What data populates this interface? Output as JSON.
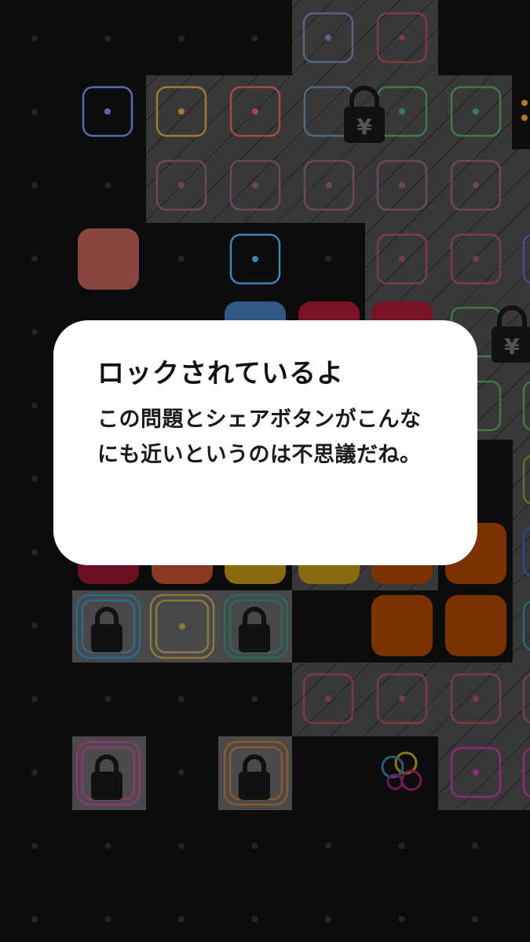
{
  "dialog": {
    "title": "ロックされているよ",
    "message": "この問題とシェアボタンがこんなにも近いというのは不思議だね。"
  },
  "board": {
    "background_color": "#0c0c0e",
    "dim_panel_color": "#36363a",
    "locked_panel_color": "#4a4a4c",
    "tiles": [
      {
        "kind": "outline",
        "color": "#5a6aa6",
        "cell": [
          1,
          1
        ],
        "icon": "dot-tile"
      },
      {
        "kind": "outline",
        "color": "#a07a34",
        "cell": [
          2,
          1
        ],
        "icon": "dot-tile"
      },
      {
        "kind": "outline",
        "color": "#a84a40",
        "cell": [
          3,
          1
        ],
        "icon": "dot-tile"
      },
      {
        "kind": "filled",
        "color": "#8a4540",
        "cell": [
          1,
          3
        ],
        "icon": "filled-tile"
      },
      {
        "kind": "outline",
        "color": "#3f86b0",
        "cell": [
          3,
          3
        ],
        "icon": "dot-tile"
      },
      {
        "kind": "filled",
        "color": "#315a86",
        "cell": [
          3,
          4
        ],
        "icon": "filled-tile"
      },
      {
        "kind": "filled",
        "color": "#7a1424",
        "cell": [
          4,
          4
        ],
        "icon": "filled-tile"
      },
      {
        "kind": "filled",
        "color": "#7a1424",
        "cell": [
          5,
          4
        ],
        "icon": "filled-tile"
      }
    ],
    "locks": [
      {
        "cell": [
          4.8,
          1.3
        ],
        "icon": "lock-yen-icon"
      },
      {
        "cell": [
          6.9,
          4.2
        ],
        "icon": "lock-yen-icon"
      },
      {
        "cell": [
          1.5,
          8.5
        ],
        "icon": "lock-icon"
      },
      {
        "cell": [
          3.5,
          8.5
        ],
        "icon": "lock-icon"
      },
      {
        "cell": [
          1.5,
          10.5
        ],
        "icon": "lock-icon"
      },
      {
        "cell": [
          3.5,
          10.5
        ],
        "icon": "lock-icon"
      }
    ],
    "share_icon": "share-circles-icon"
  }
}
